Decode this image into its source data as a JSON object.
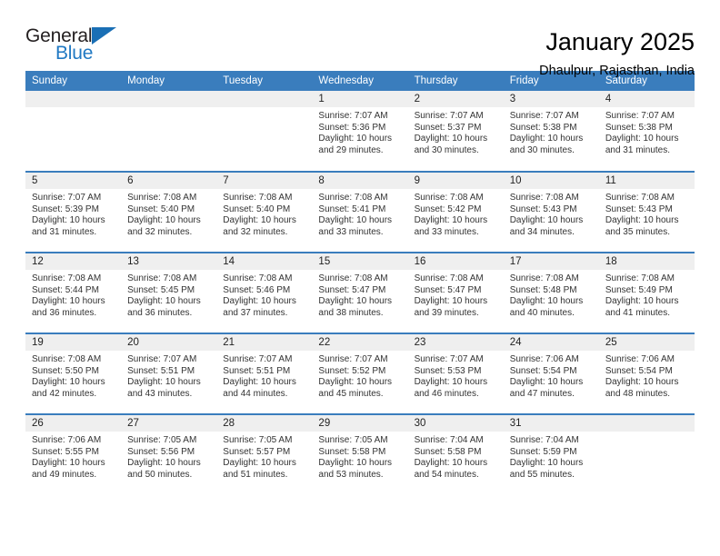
{
  "brand": {
    "name_top": "General",
    "name_bottom": "Blue",
    "accent_color": "#2079c3",
    "triangle_color": "#1a6fb5",
    "triangle_icon": "triangle-icon"
  },
  "header": {
    "title": "January 2025",
    "subtitle": "Dhaulpur, Rajasthan, India"
  },
  "theme": {
    "header_bg": "#3a7dbd",
    "header_text": "#ffffff",
    "daynum_bg": "#efefef",
    "row_divider": "#3a7dbd"
  },
  "weekdays": [
    "Sunday",
    "Monday",
    "Tuesday",
    "Wednesday",
    "Thursday",
    "Friday",
    "Saturday"
  ],
  "weeks": [
    [
      {
        "day": "",
        "sunrise": "",
        "sunset": "",
        "daylight1": "",
        "daylight2": ""
      },
      {
        "day": "",
        "sunrise": "",
        "sunset": "",
        "daylight1": "",
        "daylight2": ""
      },
      {
        "day": "",
        "sunrise": "",
        "sunset": "",
        "daylight1": "",
        "daylight2": ""
      },
      {
        "day": "1",
        "sunrise": "Sunrise: 7:07 AM",
        "sunset": "Sunset: 5:36 PM",
        "daylight1": "Daylight: 10 hours",
        "daylight2": "and 29 minutes."
      },
      {
        "day": "2",
        "sunrise": "Sunrise: 7:07 AM",
        "sunset": "Sunset: 5:37 PM",
        "daylight1": "Daylight: 10 hours",
        "daylight2": "and 30 minutes."
      },
      {
        "day": "3",
        "sunrise": "Sunrise: 7:07 AM",
        "sunset": "Sunset: 5:38 PM",
        "daylight1": "Daylight: 10 hours",
        "daylight2": "and 30 minutes."
      },
      {
        "day": "4",
        "sunrise": "Sunrise: 7:07 AM",
        "sunset": "Sunset: 5:38 PM",
        "daylight1": "Daylight: 10 hours",
        "daylight2": "and 31 minutes."
      }
    ],
    [
      {
        "day": "5",
        "sunrise": "Sunrise: 7:07 AM",
        "sunset": "Sunset: 5:39 PM",
        "daylight1": "Daylight: 10 hours",
        "daylight2": "and 31 minutes."
      },
      {
        "day": "6",
        "sunrise": "Sunrise: 7:08 AM",
        "sunset": "Sunset: 5:40 PM",
        "daylight1": "Daylight: 10 hours",
        "daylight2": "and 32 minutes."
      },
      {
        "day": "7",
        "sunrise": "Sunrise: 7:08 AM",
        "sunset": "Sunset: 5:40 PM",
        "daylight1": "Daylight: 10 hours",
        "daylight2": "and 32 minutes."
      },
      {
        "day": "8",
        "sunrise": "Sunrise: 7:08 AM",
        "sunset": "Sunset: 5:41 PM",
        "daylight1": "Daylight: 10 hours",
        "daylight2": "and 33 minutes."
      },
      {
        "day": "9",
        "sunrise": "Sunrise: 7:08 AM",
        "sunset": "Sunset: 5:42 PM",
        "daylight1": "Daylight: 10 hours",
        "daylight2": "and 33 minutes."
      },
      {
        "day": "10",
        "sunrise": "Sunrise: 7:08 AM",
        "sunset": "Sunset: 5:43 PM",
        "daylight1": "Daylight: 10 hours",
        "daylight2": "and 34 minutes."
      },
      {
        "day": "11",
        "sunrise": "Sunrise: 7:08 AM",
        "sunset": "Sunset: 5:43 PM",
        "daylight1": "Daylight: 10 hours",
        "daylight2": "and 35 minutes."
      }
    ],
    [
      {
        "day": "12",
        "sunrise": "Sunrise: 7:08 AM",
        "sunset": "Sunset: 5:44 PM",
        "daylight1": "Daylight: 10 hours",
        "daylight2": "and 36 minutes."
      },
      {
        "day": "13",
        "sunrise": "Sunrise: 7:08 AM",
        "sunset": "Sunset: 5:45 PM",
        "daylight1": "Daylight: 10 hours",
        "daylight2": "and 36 minutes."
      },
      {
        "day": "14",
        "sunrise": "Sunrise: 7:08 AM",
        "sunset": "Sunset: 5:46 PM",
        "daylight1": "Daylight: 10 hours",
        "daylight2": "and 37 minutes."
      },
      {
        "day": "15",
        "sunrise": "Sunrise: 7:08 AM",
        "sunset": "Sunset: 5:47 PM",
        "daylight1": "Daylight: 10 hours",
        "daylight2": "and 38 minutes."
      },
      {
        "day": "16",
        "sunrise": "Sunrise: 7:08 AM",
        "sunset": "Sunset: 5:47 PM",
        "daylight1": "Daylight: 10 hours",
        "daylight2": "and 39 minutes."
      },
      {
        "day": "17",
        "sunrise": "Sunrise: 7:08 AM",
        "sunset": "Sunset: 5:48 PM",
        "daylight1": "Daylight: 10 hours",
        "daylight2": "and 40 minutes."
      },
      {
        "day": "18",
        "sunrise": "Sunrise: 7:08 AM",
        "sunset": "Sunset: 5:49 PM",
        "daylight1": "Daylight: 10 hours",
        "daylight2": "and 41 minutes."
      }
    ],
    [
      {
        "day": "19",
        "sunrise": "Sunrise: 7:08 AM",
        "sunset": "Sunset: 5:50 PM",
        "daylight1": "Daylight: 10 hours",
        "daylight2": "and 42 minutes."
      },
      {
        "day": "20",
        "sunrise": "Sunrise: 7:07 AM",
        "sunset": "Sunset: 5:51 PM",
        "daylight1": "Daylight: 10 hours",
        "daylight2": "and 43 minutes."
      },
      {
        "day": "21",
        "sunrise": "Sunrise: 7:07 AM",
        "sunset": "Sunset: 5:51 PM",
        "daylight1": "Daylight: 10 hours",
        "daylight2": "and 44 minutes."
      },
      {
        "day": "22",
        "sunrise": "Sunrise: 7:07 AM",
        "sunset": "Sunset: 5:52 PM",
        "daylight1": "Daylight: 10 hours",
        "daylight2": "and 45 minutes."
      },
      {
        "day": "23",
        "sunrise": "Sunrise: 7:07 AM",
        "sunset": "Sunset: 5:53 PM",
        "daylight1": "Daylight: 10 hours",
        "daylight2": "and 46 minutes."
      },
      {
        "day": "24",
        "sunrise": "Sunrise: 7:06 AM",
        "sunset": "Sunset: 5:54 PM",
        "daylight1": "Daylight: 10 hours",
        "daylight2": "and 47 minutes."
      },
      {
        "day": "25",
        "sunrise": "Sunrise: 7:06 AM",
        "sunset": "Sunset: 5:54 PM",
        "daylight1": "Daylight: 10 hours",
        "daylight2": "and 48 minutes."
      }
    ],
    [
      {
        "day": "26",
        "sunrise": "Sunrise: 7:06 AM",
        "sunset": "Sunset: 5:55 PM",
        "daylight1": "Daylight: 10 hours",
        "daylight2": "and 49 minutes."
      },
      {
        "day": "27",
        "sunrise": "Sunrise: 7:05 AM",
        "sunset": "Sunset: 5:56 PM",
        "daylight1": "Daylight: 10 hours",
        "daylight2": "and 50 minutes."
      },
      {
        "day": "28",
        "sunrise": "Sunrise: 7:05 AM",
        "sunset": "Sunset: 5:57 PM",
        "daylight1": "Daylight: 10 hours",
        "daylight2": "and 51 minutes."
      },
      {
        "day": "29",
        "sunrise": "Sunrise: 7:05 AM",
        "sunset": "Sunset: 5:58 PM",
        "daylight1": "Daylight: 10 hours",
        "daylight2": "and 53 minutes."
      },
      {
        "day": "30",
        "sunrise": "Sunrise: 7:04 AM",
        "sunset": "Sunset: 5:58 PM",
        "daylight1": "Daylight: 10 hours",
        "daylight2": "and 54 minutes."
      },
      {
        "day": "31",
        "sunrise": "Sunrise: 7:04 AM",
        "sunset": "Sunset: 5:59 PM",
        "daylight1": "Daylight: 10 hours",
        "daylight2": "and 55 minutes."
      },
      {
        "day": "",
        "sunrise": "",
        "sunset": "",
        "daylight1": "",
        "daylight2": ""
      }
    ]
  ]
}
